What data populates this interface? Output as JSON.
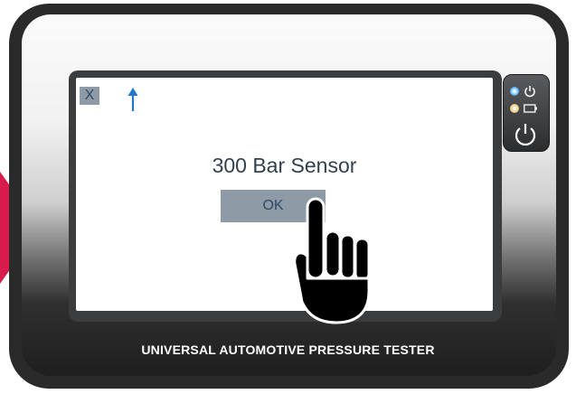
{
  "colors": {
    "accent": "#d81b4a",
    "button_bg": "#8e9aa6",
    "button_text": "#2f4a66",
    "screen_text": "#33414f"
  },
  "screen": {
    "close_label": "X",
    "up_icon": "arrow-up-icon",
    "message": "300 Bar Sensor",
    "ok_label": "OK"
  },
  "device": {
    "label": "UNIVERSAL AUTOMOTIVE PRESSURE TESTER",
    "icons": [
      "power-status-icon",
      "battery-icon",
      "power-button-icon"
    ]
  },
  "overlay": {
    "icon": "pointing-hand-icon"
  }
}
